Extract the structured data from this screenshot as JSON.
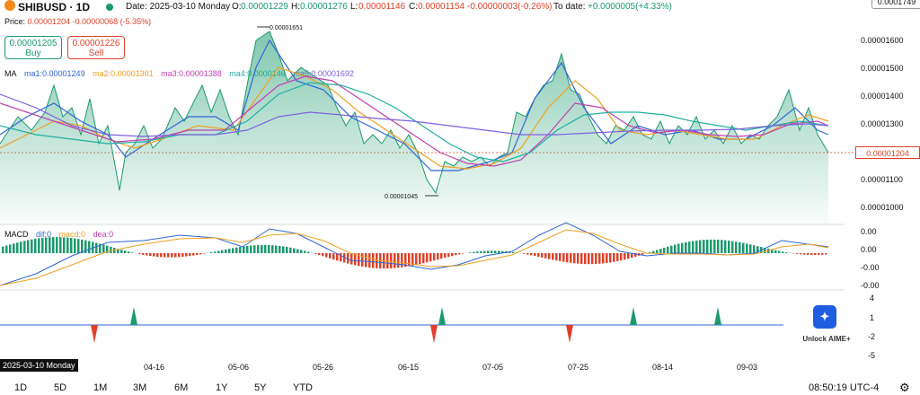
{
  "header": {
    "symbol": "SHIBUSD · 1D",
    "date_label": "Date: 2025-03-10 Monday",
    "open_label": "O:",
    "open": "0.00001229",
    "high_label": "H:",
    "high": "0.00001276",
    "low_label": "L:",
    "low": "0.00001146",
    "close_label": "C:",
    "close": "0.00001154",
    "change": "-0.00000003(-0.26%)",
    "todate_label": "To date:",
    "todate": "+0.0000005(+4.33%)"
  },
  "price_line": {
    "label": "Price:",
    "value": "0.00001204 -0.00000068 (-5.35%)"
  },
  "buttons": {
    "buy_price": "0.00001205",
    "buy_label": "Buy",
    "sell_price": "0.00001226",
    "sell_label": "Sell"
  },
  "ma": {
    "title": "MA",
    "ma1": "ma1:0.00001249",
    "ma2": "ma2:0.00001301",
    "ma3": "ma3:0.00001388",
    "ma4": "ma4:0.0000146",
    "ma5": "ma5:0.00001692"
  },
  "macd": {
    "title": "MACD",
    "dif": "dif:0",
    "macd": "macd:0",
    "dea": "dea:0"
  },
  "price_axis": [
    "0.00001600",
    "0.00001500",
    "0.00001400",
    "0.00001300",
    "0.00001100",
    "0.00001000"
  ],
  "current_price_badge": "0.00001204",
  "top_badge": "0.0001749",
  "annotations": {
    "high": "0.00001651",
    "low": "0.00001045"
  },
  "macd_axis": [
    "0.00",
    "0.00",
    "-0.00",
    "-0.00"
  ],
  "signal_axis": [
    "4",
    "1",
    "-2",
    "-5"
  ],
  "x_axis": [
    "04-16",
    "05-06",
    "05-26",
    "06-15",
    "07-05",
    "07-25",
    "08-14",
    "09-03"
  ],
  "crosshair_date": "2025-03-10 Monday",
  "timeframes": [
    "1D",
    "5D",
    "1M",
    "3M",
    "6M",
    "1Y",
    "5Y",
    "YTD"
  ],
  "clock": "08:50:19 UTC-4",
  "aime": {
    "label": "Unlock AIME+",
    "icon": "aime-logo-icon"
  },
  "colors": {
    "up": "#1a9a6c",
    "down": "#e0402a",
    "ma1": "#2f66d8",
    "ma2": "#f0a020",
    "ma3": "#c040b0",
    "ma4": "#20b0a0",
    "ma5": "#8060e0"
  }
}
